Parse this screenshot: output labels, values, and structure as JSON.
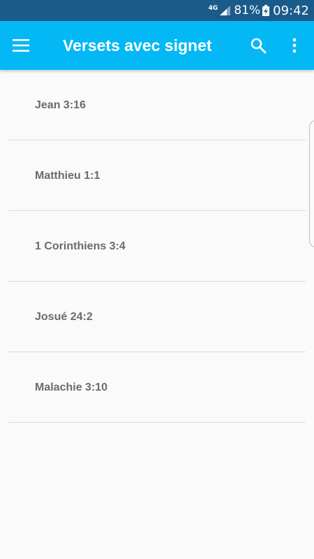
{
  "status_bar": {
    "network": "4G",
    "battery_percent": "81%",
    "time": "09:42",
    "icons": [
      "signal-icon",
      "battery-charging-icon"
    ]
  },
  "app_bar": {
    "title": "Versets avec signet",
    "icons": [
      "menu-icon",
      "search-icon",
      "more-vert-icon"
    ],
    "background": "#03b8f5"
  },
  "bookmarks": [
    {
      "label": "Jean 3:16"
    },
    {
      "label": "Matthieu 1:1"
    },
    {
      "label": "1 Corinthiens 3:4"
    },
    {
      "label": "Josué 24:2"
    },
    {
      "label": "Malachie 3:10"
    }
  ],
  "colors": {
    "status_bar": "#1b5b8a",
    "app_bar": "#03b8f5",
    "background": "#fafafa",
    "item_text": "#6b6b6b",
    "divider": "#dcdcdc"
  }
}
